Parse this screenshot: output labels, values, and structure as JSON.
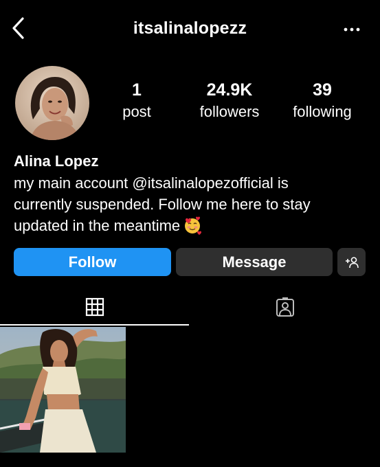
{
  "header": {
    "username": "itsalinalopezz",
    "back_icon": "chevron-left-icon",
    "more_icon": "more-horizontal-icon"
  },
  "profile": {
    "avatar_icon": "profile-avatar",
    "stats": [
      {
        "number": "1",
        "label": "post"
      },
      {
        "number": "24.9K",
        "label": "followers"
      },
      {
        "number": "39",
        "label": "following"
      }
    ],
    "name": "Alina Lopez",
    "bio_lines": [
      "my main account @itsalinalopezofficial is",
      "currently suspended. Follow me here to stay",
      "updated in the meantime"
    ],
    "bio_emoji": "smiling-face-with-hearts-icon"
  },
  "actions": {
    "follow_label": "Follow",
    "message_label": "Message",
    "add_user_icon": "add-user-icon"
  },
  "tabs": [
    {
      "icon": "grid-icon",
      "active": true
    },
    {
      "icon": "tagged-person-icon",
      "active": false
    }
  ],
  "colors": {
    "background": "#000000",
    "follow_button": "#1f93f3",
    "secondary_button": "#2f2f2f",
    "text": "#ffffff"
  }
}
